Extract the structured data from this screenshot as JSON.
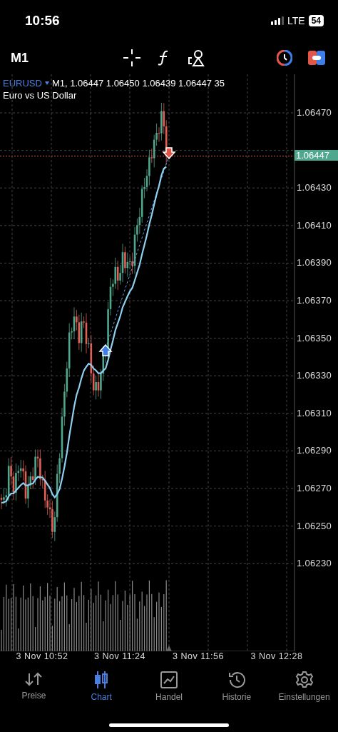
{
  "status_bar": {
    "time": "10:56",
    "network": "LTE",
    "battery": "54"
  },
  "toolbar": {
    "timeframe": "M1"
  },
  "chart": {
    "symbol": "EURUSD",
    "ohlc": "M1, 1.06447 1.06450 1.06439 1.06447 35",
    "description": "Euro vs US Dollar",
    "price_labels": [
      "1.06470",
      "1.06430",
      "1.06410",
      "1.06390",
      "1.06370",
      "1.06350",
      "1.06330",
      "1.06310",
      "1.06290",
      "1.06270",
      "1.06250",
      "1.06230"
    ],
    "current_price": "1.06447",
    "time_labels": [
      "3 Nov 10:52",
      "3 Nov 11:24",
      "3 Nov 11:56",
      "3 Nov 12:28"
    ]
  },
  "tabs": [
    {
      "label": "Preise",
      "kind": "prices",
      "selected": false
    },
    {
      "label": "Chart",
      "kind": "chart",
      "selected": true
    },
    {
      "label": "Handel",
      "kind": "trade",
      "selected": false
    },
    {
      "label": "Historie",
      "kind": "history",
      "selected": false
    },
    {
      "label": "Einstellungen",
      "kind": "settings",
      "selected": false
    }
  ]
}
